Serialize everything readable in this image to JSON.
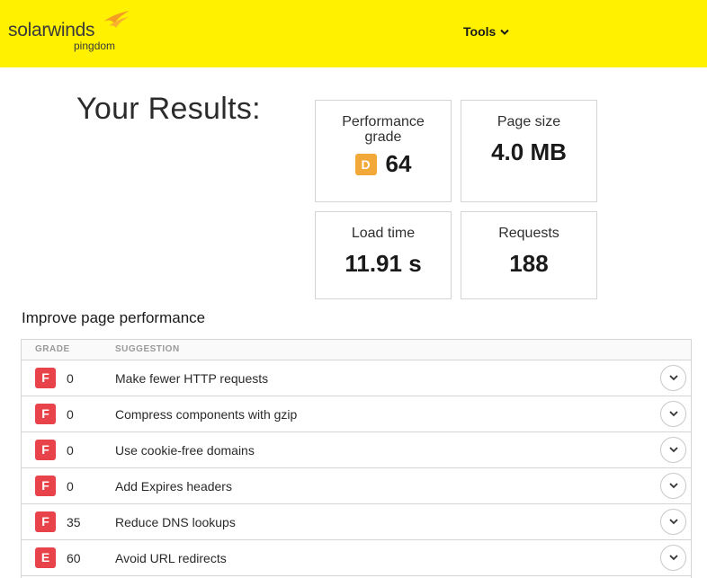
{
  "header": {
    "logo_main": "solarwinds",
    "logo_sub": "pingdom",
    "tools_label": "Tools",
    "bg_color": "#fff100"
  },
  "results": {
    "title": "Your Results:",
    "cards": [
      {
        "label_line1": "Performance",
        "label_line2": "grade",
        "grade_letter": "D",
        "value": "64"
      },
      {
        "label": "Page size",
        "value": "4.0 MB"
      },
      {
        "label": "Load time",
        "value": "11.91 s"
      },
      {
        "label": "Requests",
        "value": "188"
      }
    ]
  },
  "improve": {
    "title": "Improve page performance",
    "col_grade": "GRADE",
    "col_suggestion": "SUGGESTION",
    "rows": [
      {
        "grade": "F",
        "score": "0",
        "suggestion": "Make fewer HTTP requests"
      },
      {
        "grade": "F",
        "score": "0",
        "suggestion": "Compress components with gzip"
      },
      {
        "grade": "F",
        "score": "0",
        "suggestion": "Use cookie-free domains"
      },
      {
        "grade": "F",
        "score": "0",
        "suggestion": "Add Expires headers"
      },
      {
        "grade": "F",
        "score": "35",
        "suggestion": "Reduce DNS lookups"
      },
      {
        "grade": "E",
        "score": "60",
        "suggestion": "Avoid URL redirects"
      }
    ]
  },
  "colors": {
    "grade_d": "#f3a93a",
    "grade_f": "#e8424a"
  }
}
